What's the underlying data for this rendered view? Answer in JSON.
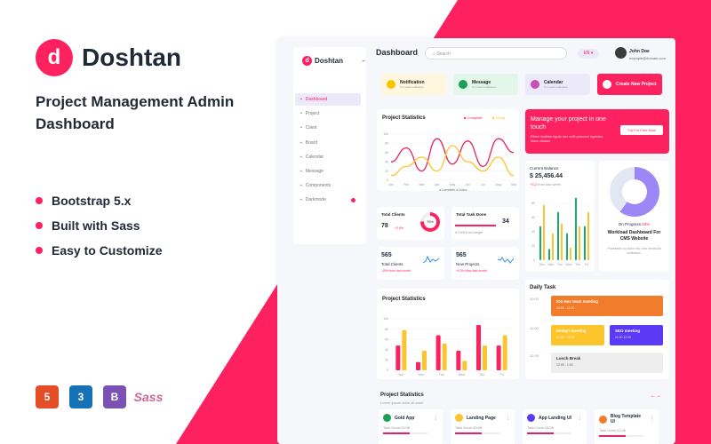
{
  "hero": {
    "brand": "Doshtan",
    "subtitle": "Project Management Admin Dashboard",
    "features": [
      "Bootstrap 5.x",
      "Built with Sass",
      "Easy to Customize"
    ],
    "tech_icons": [
      {
        "name": "html5-icon",
        "label": "5",
        "color": "#e44d26"
      },
      {
        "name": "css3-icon",
        "label": "3",
        "color": "#1572b6"
      },
      {
        "name": "bootstrap-icon",
        "label": "B",
        "color": "#7952b3"
      },
      {
        "name": "sass-icon",
        "label": "Sass",
        "color": "#cd6799"
      }
    ],
    "accent": "#fe2160"
  },
  "app": {
    "brand": "Doshtan",
    "page_title": "Dashboard",
    "search_placeholder": "Search",
    "language": "EN",
    "user_name": "John Doe",
    "user_email": "example@domain.com"
  },
  "sidebar": {
    "items": [
      {
        "label": "Dashboard",
        "active": true
      },
      {
        "label": "Project"
      },
      {
        "label": "Client"
      },
      {
        "label": "Board"
      },
      {
        "label": "Calendar"
      },
      {
        "label": "Message"
      },
      {
        "label": "Components"
      },
      {
        "label": "Darkmode"
      }
    ]
  },
  "quick_actions": [
    {
      "label": "Notification",
      "desc": "5 unread notification",
      "bg": "#fff7dd",
      "icon": "#f7c600"
    },
    {
      "label": "Message",
      "desc": "5 unread notification",
      "bg": "#e3f6ea",
      "icon": "#1aa053"
    },
    {
      "label": "Calendar",
      "desc": "5 unread notification",
      "bg": "#ece9fb",
      "icon": "#c94fb8"
    },
    {
      "label": "Create New Project",
      "desc": "",
      "bg": "#fe2160",
      "icon": "#ffffff"
    }
  ],
  "promo": {
    "title": "Manage your project in one touch",
    "text": "Etiam facilisis ligula nec velit posuere egestas. Nunc dictum",
    "button": "Try For Free Now"
  },
  "balance": {
    "label": "Current Balance",
    "value": "$ 25,456.44",
    "change": "+3.2",
    "change_text": "from last week"
  },
  "workload": {
    "status_label": "On Progress",
    "percent": "60%",
    "title": "Workload Dashboard For CMS Website",
    "desc": "Praesent eu dolor eu orci vehicula euismod."
  },
  "stats": {
    "total_clients_label": "Total Clients",
    "total_clients": "78",
    "total_clients_change": "+2.5%",
    "donut": "76%",
    "task_done_label": "Total Task Done",
    "task_done": "34",
    "task_done_note": "67 left from target",
    "clients2": "565",
    "clients2_label": "Total Clients",
    "clients2_note": "-15% from last month",
    "projects": "565",
    "projects_label": "New Projects",
    "projects_note": "+0.5% than last month"
  },
  "line_chart": {
    "title": "Project Statistics",
    "type": "line",
    "categories": [
      "Jan",
      "Feb",
      "Mar",
      "Apr",
      "May",
      "Jun",
      "Jul",
      "Aug",
      "Sep"
    ],
    "ylim": [
      0,
      100
    ],
    "yticks": [
      "0",
      "20",
      "40",
      "60",
      "80",
      "100"
    ],
    "series": [
      {
        "name": "Complete",
        "color": "#e3245e",
        "values": [
          40,
          70,
          20,
          90,
          35,
          85,
          30,
          90,
          60
        ]
      },
      {
        "name": "Doing",
        "color": "#fcc52e",
        "values": [
          10,
          30,
          50,
          20,
          75,
          40,
          20,
          50,
          10
        ]
      }
    ]
  },
  "balance_chart": {
    "type": "bar",
    "categories": [
      "Sun",
      "Mon",
      "Tue",
      "Wed",
      "Thu",
      "Fri"
    ],
    "ylim": [
      0,
      80
    ],
    "yticks": [
      "0",
      "20",
      "40",
      "60",
      "80"
    ],
    "series": [
      {
        "color": "#1aaa6e",
        "values": [
          48,
          16,
          68,
          38,
          88,
          48
        ]
      },
      {
        "color": "#fcc52e",
        "values": [
          78,
          38,
          52,
          18,
          48,
          68
        ]
      }
    ]
  },
  "bar_chart": {
    "title": "Project Statistics",
    "type": "bar",
    "categories": [
      "Sun",
      "Mon",
      "Tue",
      "Wed",
      "Thu",
      "Fri"
    ],
    "ylim": [
      0,
      100
    ],
    "yticks": [
      "0",
      "20",
      "40",
      "60",
      "80",
      "100"
    ],
    "series": [
      {
        "color": "#fe2160",
        "values": [
          48,
          16,
          68,
          38,
          88,
          48
        ]
      },
      {
        "color": "#fcc52e",
        "values": [
          78,
          38,
          52,
          18,
          48,
          68
        ]
      }
    ]
  },
  "daily_task": {
    "title": "Daily Task",
    "times": [
      "10:00",
      "11:00",
      "12:00"
    ],
    "tasks": [
      {
        "title": "IOs Dev team meeting",
        "time": "10:00 - 11:00",
        "color": "#f17d2c"
      },
      {
        "title": "Design meeting",
        "time": "11:00 - 12:00",
        "color": "#fcc52e"
      },
      {
        "title": "SEO meeting",
        "time": "11:00 12:00",
        "color": "#5b3af5"
      },
      {
        "title": "Lunch Break",
        "time": "12:00 - 1:00",
        "color": "#eeeeee"
      }
    ]
  },
  "projects": {
    "title": "Project Statistics",
    "subtitle": "Lorem ipsum dolor sit amet",
    "items": [
      {
        "name": "Gold App",
        "task": "Task Done:22/48",
        "color": "#1aa053"
      },
      {
        "name": "Landing Page",
        "task": "Task Done:30/48",
        "color": "#fcc52e"
      },
      {
        "name": "App Landing UI",
        "task": "Task Done:28/36",
        "color": "#5b3af5"
      },
      {
        "name": "Blog Template UI",
        "task": "Task Done:21/45",
        "color": "#f17d2c"
      }
    ]
  }
}
